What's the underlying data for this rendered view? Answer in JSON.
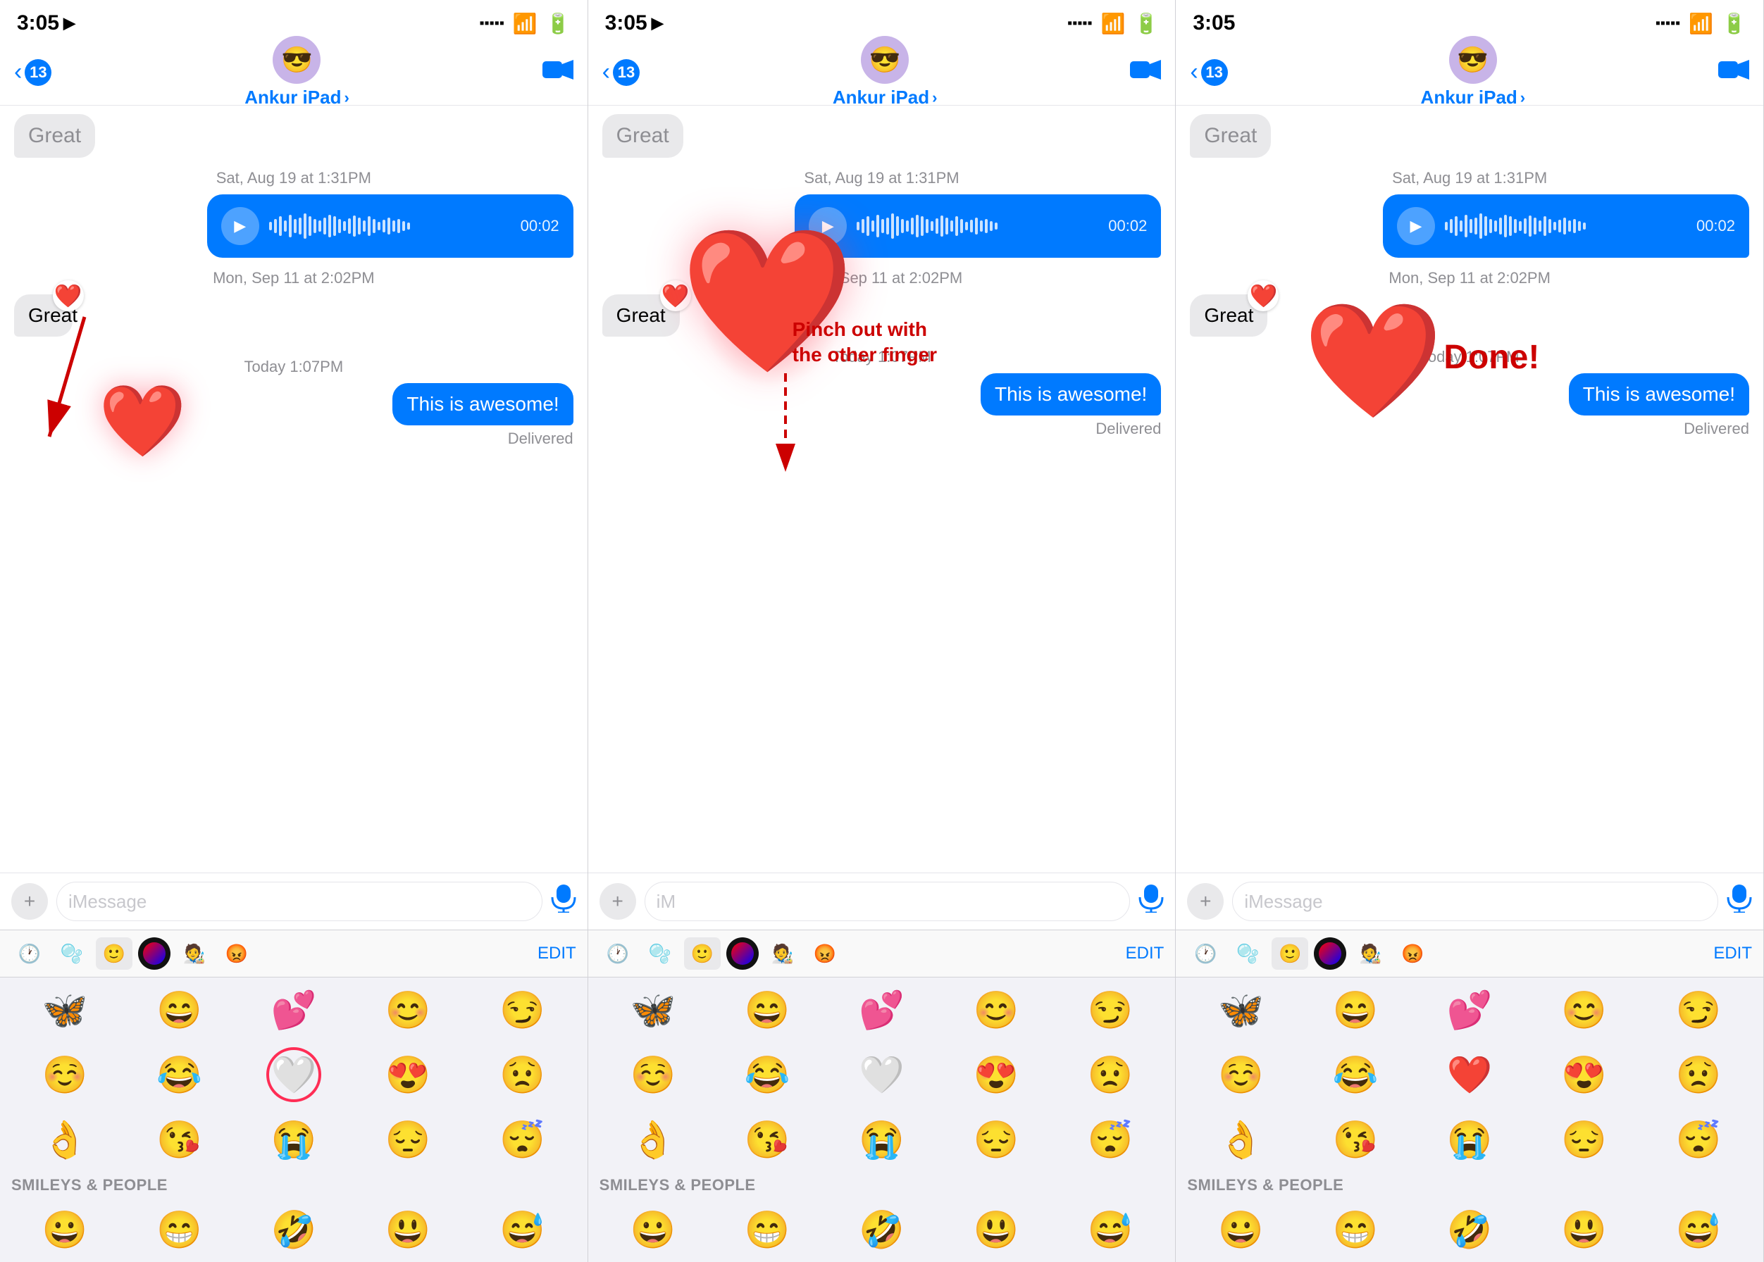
{
  "panels": [
    {
      "id": "panel-1",
      "status_time": "3:05",
      "nav_back_count": "13",
      "nav_name": "Ankur iPad",
      "audio_time": "00:02",
      "timestamp1": "Sat, Aug 19 at 1:31PM",
      "timestamp2": "Mon, Sep 11 at 2:02PM",
      "timestamp3": "Today 1:07PM",
      "received_msg": "Great",
      "sent_msg": "This is awesome!",
      "delivered": "Delivered",
      "input_placeholder": "iMessage",
      "edit_label": "EDIT",
      "section_label": "SMILEYS & PEOPLE",
      "emojis_row1": [
        "🦋",
        "😄",
        "💕",
        "😊",
        "😏"
      ],
      "emojis_row2": [
        "☺️",
        "😂",
        "🤍",
        "😍",
        "😟"
      ],
      "emojis_row3": [
        "👌",
        "😘",
        "😭",
        "😔",
        "😴"
      ]
    },
    {
      "id": "panel-2",
      "status_time": "3:05",
      "nav_back_count": "13",
      "nav_name": "Ankur iPad",
      "audio_time": "00:02",
      "timestamp1": "Sat, Aug 19 at 1:31PM",
      "timestamp2": "Mon, Sep 11 at 2:02PM",
      "timestamp3": "Today 1:07PM",
      "received_msg": "Great",
      "sent_msg": "This is awesome!",
      "delivered": "Delivered",
      "input_placeholder": "iM",
      "edit_label": "EDIT",
      "section_label": "SMILEYS & PEOPLE",
      "pinch_text": "Pinch out with\nthe other finger",
      "emojis_row1": [
        "🦋",
        "😄",
        "💕",
        "😊",
        "😏"
      ],
      "emojis_row2": [
        "☺️",
        "😂",
        "🤍",
        "😍",
        "😟"
      ],
      "emojis_row3": [
        "👌",
        "😘",
        "😭",
        "😔",
        "😴"
      ]
    },
    {
      "id": "panel-3",
      "status_time": "3:05",
      "nav_back_count": "13",
      "nav_name": "Ankur iPad",
      "audio_time": "00:02",
      "timestamp1": "Sat, Aug 19 at 1:31PM",
      "timestamp2": "Mon, Sep 11 at 2:02PM",
      "timestamp3": "Today 1:07PM",
      "received_msg": "Great",
      "sent_msg": "This is awesome!",
      "delivered": "Delivered",
      "input_placeholder": "iMessage",
      "edit_label": "EDIT",
      "section_label": "SMILEYS & PEOPLE",
      "done_text": "Done!",
      "emojis_row1": [
        "🦋",
        "😄",
        "💕",
        "😊",
        "😏"
      ],
      "emojis_row2": [
        "☺️",
        "😂",
        "❤️",
        "😍",
        "😟"
      ],
      "emojis_row3": [
        "👌",
        "😘",
        "😭",
        "😔",
        "😴"
      ]
    }
  ]
}
